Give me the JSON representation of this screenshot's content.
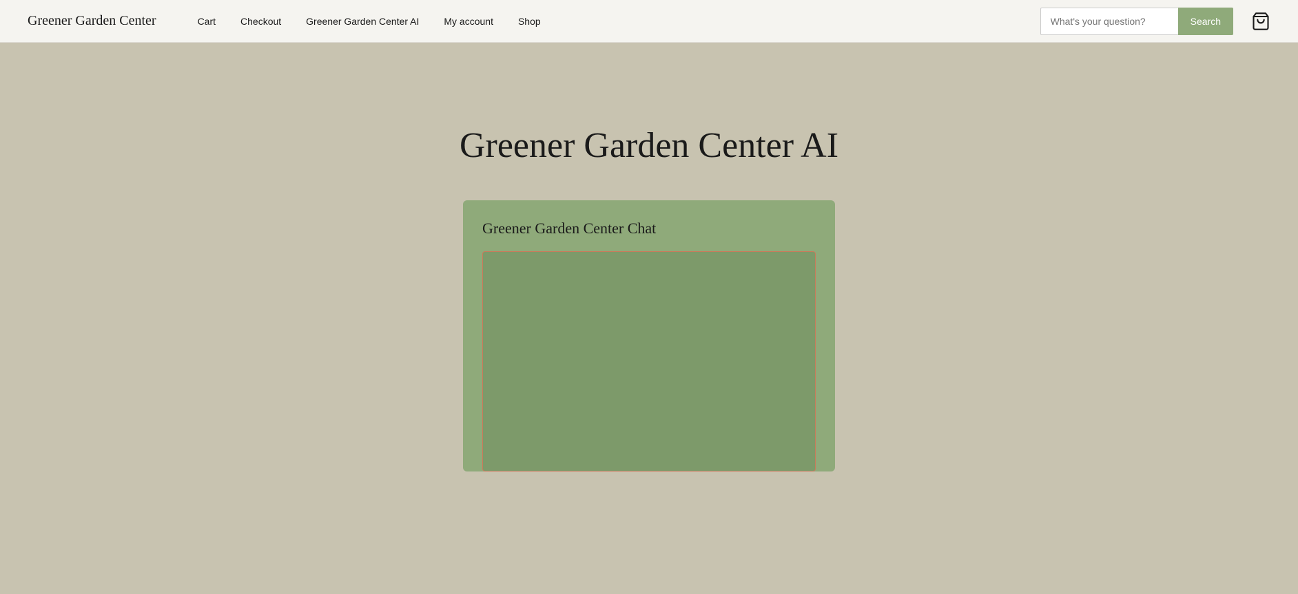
{
  "site": {
    "title": "Greener Garden Center"
  },
  "nav": {
    "links": [
      {
        "label": "Cart",
        "href": "#"
      },
      {
        "label": "Checkout",
        "href": "#"
      },
      {
        "label": "Greener Garden Center AI",
        "href": "#"
      },
      {
        "label": "My account",
        "href": "#"
      },
      {
        "label": "Shop",
        "href": "#"
      }
    ]
  },
  "search": {
    "placeholder": "What's your question?",
    "button_label": "Search"
  },
  "main": {
    "page_title": "Greener Garden Center AI",
    "chat_widget_title": "Greener Garden Center Chat"
  }
}
